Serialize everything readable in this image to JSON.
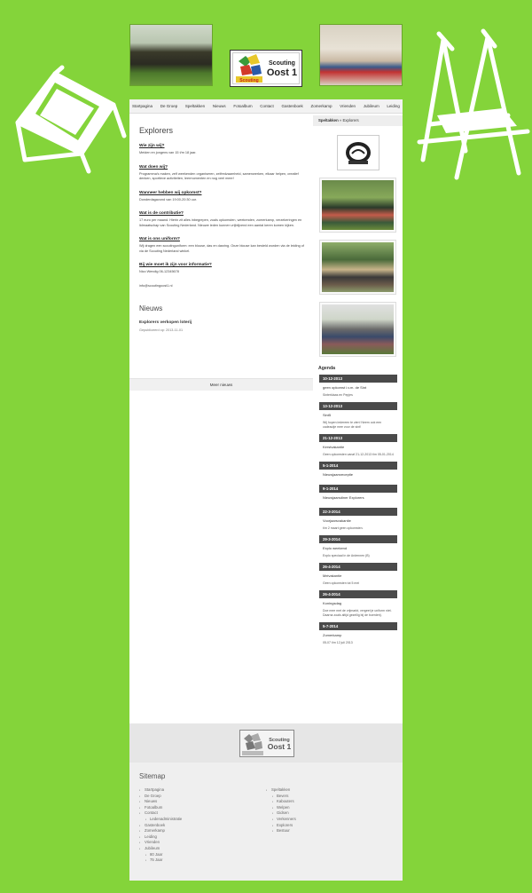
{
  "header": {
    "logo": {
      "line1": "Scouting",
      "line2": "Oost 1",
      "sub": "Scouting"
    }
  },
  "nav": [
    "Startpagina",
    "De Groep",
    "Speltakken",
    "Nieuws",
    "Fotoalbum",
    "Contact",
    "Gastenboek",
    "Zomerkamp",
    "Vrienden",
    "Jubileum",
    "Leiding"
  ],
  "breadcrumb": {
    "parent": "Speltakken",
    "separator": "»",
    "current": "Explorers"
  },
  "main": {
    "title": "Explorers",
    "sections": [
      {
        "q": "Wie zijn wij?",
        "a": "Meiden en jongens van 15 t/m 18 jaar."
      },
      {
        "q": "Wat doen wij?",
        "a": "Programma's maken, zelf weekenden organiseren, zelfredzaamheid, samenwerken, elkaar helpen, creatief denken, sportieve activiteiten, leermomenten en nog veel meer!"
      },
      {
        "q": "Wanneer hebben wij opkomst?",
        "a": "Donderdagavond van 19:00-20:30 uur."
      },
      {
        "q": "Wat is de contributie?",
        "a": "17 euro per maand. Hierin zit alles inbegrepen, zoals opkomsten, weekenden, zomerkamp, verzekeringen en lidmaatschap van Scouting Nederland. Nieuwe leden kunnen vrijblijvend een aantal keren komen kijken."
      },
      {
        "q": "Wat is ons uniform?",
        "a": "Wij dragen een scoutinguniform: een blouse, das en dasring. Onze blouse kan besteld worden via de leiding of via de Scouting Nederland winkel."
      },
      {
        "q": "Bij wie moet ik zijn voor informatie?",
        "a": "Nico Wendig 06-12345678"
      }
    ],
    "email": "info@scoutingoost1.nl"
  },
  "news": {
    "title": "Nieuws",
    "items": [
      {
        "title": "Explorers verkopen loterij",
        "date": "Gepubliceerd op: 2013-11-01"
      }
    ],
    "more": "Meer nieuws"
  },
  "agenda": {
    "title": "Agenda",
    "items": [
      {
        "date": "10-12-2013",
        "title": "geen opkomst i.v.m. de Sint",
        "desc": "Sinterklaas en Pepjes"
      },
      {
        "date": "13-12-2013",
        "title": "Sint5",
        "desc": "Wij hopen iedereen te zien! Neem ook een cadeautje mee voor de sint!"
      },
      {
        "date": "21-12-2013",
        "title": "Kerstvakantie",
        "desc": "Geen opkomsten vanaf 21-12-2013 t/m 05-01-2014"
      },
      {
        "date": "5-1-2014",
        "title": "Nieuwjaarsreceptie",
        "desc": ""
      },
      {
        "date": "9-1-2014",
        "title": "Nieuwjaarsdiner Explorers",
        "desc": ""
      },
      {
        "date": "22-3-2014",
        "title": "Voorjaarsvakantie",
        "desc": "t/m 2 maart geen opkomsten."
      },
      {
        "date": "29-3-2014",
        "title": "Explo weekend",
        "desc": "Explo speciaal in de Ardennen (B)"
      },
      {
        "date": "26-4-2014",
        "title": "Meivakantie",
        "desc": "Geen opkomsten tot 5 mei"
      },
      {
        "date": "26-4-2014",
        "title": "Koningsdag",
        "desc": "Doe mee met de vrijmarkt, vergeet je uniform niet. Daarna zoals altijd gezellig bij de boerderij."
      },
      {
        "date": "5-7-2014",
        "title": "Zomerkamp",
        "desc": "05-07 t/m 12 juli 2013"
      }
    ]
  },
  "sitemap": {
    "title": "Sitemap",
    "col1": [
      {
        "label": "Startpagina",
        "sub": false
      },
      {
        "label": "De Groep",
        "sub": false
      },
      {
        "label": "Nieuws",
        "sub": false
      },
      {
        "label": "Fotoalbum",
        "sub": false
      },
      {
        "label": "Contact",
        "sub": false
      },
      {
        "label": "Ledenadministratie",
        "sub": true
      },
      {
        "label": "Gastenboek",
        "sub": false
      },
      {
        "label": "Zomerkamp",
        "sub": false
      },
      {
        "label": "Leiding",
        "sub": false
      },
      {
        "label": "Vrienden",
        "sub": false
      },
      {
        "label": "Jubileum",
        "sub": false
      },
      {
        "label": "80 Jaar",
        "sub": true
      },
      {
        "label": "75 Jaar",
        "sub": true
      }
    ],
    "col2": [
      {
        "label": "Speltakken",
        "sub": false
      },
      {
        "label": "Bevers",
        "sub": true
      },
      {
        "label": "Kabouters",
        "sub": true
      },
      {
        "label": "Welpen",
        "sub": true
      },
      {
        "label": "Gidsen",
        "sub": true
      },
      {
        "label": "Verkenners",
        "sub": true
      },
      {
        "label": "Explorers",
        "sub": true
      },
      {
        "label": "Bestuur",
        "sub": true
      }
    ]
  }
}
